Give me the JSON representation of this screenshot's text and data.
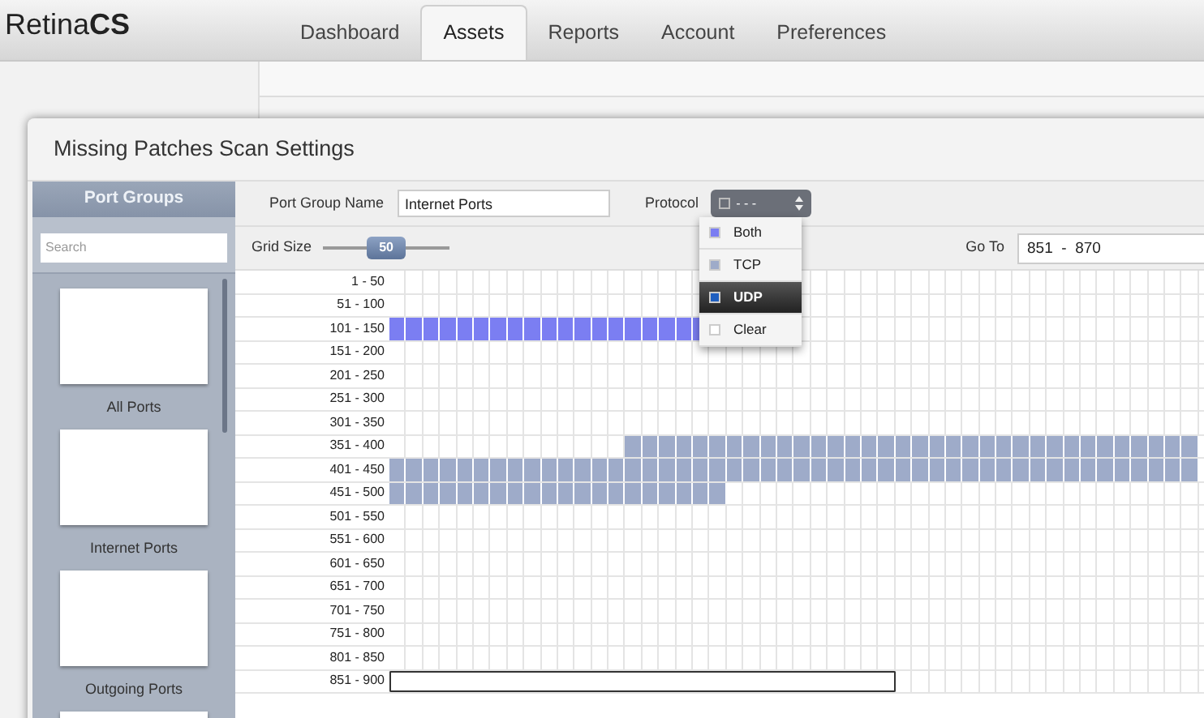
{
  "logo": "Retina**CS**",
  "tabs": [
    {
      "label": "Dashboard",
      "selected": false
    },
    {
      "label": "Assets",
      "selected": true
    },
    {
      "label": "Reports",
      "selected": false
    },
    {
      "label": "Account",
      "selected": false
    },
    {
      "label": "Preferences",
      "selected": false
    }
  ],
  "dialog": {
    "title": "Missing Patches Scan Settings",
    "sidebar": {
      "title": "Port Groups",
      "search": {
        "placeholder": "Search"
      },
      "groups": [
        {
          "label": "All Ports"
        },
        {
          "label": "Internet Ports"
        },
        {
          "label": "Outgoing Ports"
        }
      ],
      "more_below": true
    },
    "port_group_name": {
      "label": "Port Group Name",
      "value": "Internet Ports"
    },
    "protocol": {
      "label": "Protocol",
      "value": "- - -",
      "expanded": true,
      "options": [
        {
          "label": "Both",
          "color": "#7b7ef2",
          "selected": false
        },
        {
          "label": "TCP",
          "color": "#9eabc9",
          "selected": false
        },
        {
          "label": "UDP",
          "color": "#1f5fc0",
          "selected": true
        },
        {
          "label": "Clear",
          "color": "#ffffff",
          "selected": false
        }
      ]
    },
    "grid_size": {
      "label": "Grid Size",
      "value": "50",
      "level": 0.5
    },
    "go_to": {
      "label": "Go To",
      "value": "851  -  870"
    },
    "grid": {
      "rows": [
        {
          "label": "1 - 50"
        },
        {
          "label": "51 - 100"
        },
        {
          "label": "101 - 150",
          "cells": [
            {
              "kind": "both"
            },
            {
              "kind": "both"
            },
            {
              "kind": "both"
            },
            {
              "kind": "both"
            },
            {
              "kind": "both"
            },
            {
              "kind": "both"
            },
            {
              "kind": "both"
            },
            {
              "kind": "both"
            },
            {
              "kind": "both"
            },
            {
              "kind": "both"
            },
            {
              "kind": "both"
            },
            {
              "kind": "both"
            },
            {
              "kind": "both"
            },
            {
              "kind": "both"
            },
            {
              "kind": "both"
            },
            {
              "kind": "both"
            },
            {
              "kind": "both"
            },
            {
              "kind": "both"
            },
            {
              "kind": "both"
            }
          ]
        },
        {
          "label": "151 - 200"
        },
        {
          "label": "201 - 250"
        },
        {
          "label": "251 - 300"
        },
        {
          "label": "301 - 350"
        },
        {
          "label": "351 - 400",
          "cells": [
            {
              "kind": "empty"
            },
            {
              "kind": "empty"
            },
            {
              "kind": "empty"
            },
            {
              "kind": "empty"
            },
            {
              "kind": "empty"
            },
            {
              "kind": "empty"
            },
            {
              "kind": "empty"
            },
            {
              "kind": "empty"
            },
            {
              "kind": "empty"
            },
            {
              "kind": "empty"
            },
            {
              "kind": "empty"
            },
            {
              "kind": "empty"
            },
            {
              "kind": "empty"
            },
            {
              "kind": "empty"
            },
            {
              "kind": "tcp"
            },
            {
              "kind": "tcp"
            },
            {
              "kind": "tcp"
            },
            {
              "kind": "tcp"
            },
            {
              "kind": "tcp"
            },
            {
              "kind": "tcp"
            },
            {
              "kind": "tcp"
            },
            {
              "kind": "tcp"
            },
            {
              "kind": "tcp"
            },
            {
              "kind": "tcp"
            },
            {
              "kind": "tcp"
            },
            {
              "kind": "tcp"
            },
            {
              "kind": "tcp"
            },
            {
              "kind": "tcp"
            },
            {
              "kind": "tcp"
            },
            {
              "kind": "tcp"
            },
            {
              "kind": "tcp"
            },
            {
              "kind": "tcp"
            },
            {
              "kind": "tcp"
            },
            {
              "kind": "tcp"
            },
            {
              "kind": "tcp"
            },
            {
              "kind": "tcp"
            },
            {
              "kind": "tcp"
            },
            {
              "kind": "tcp"
            },
            {
              "kind": "tcp"
            },
            {
              "kind": "tcp"
            },
            {
              "kind": "tcp"
            },
            {
              "kind": "tcp"
            },
            {
              "kind": "tcp"
            },
            {
              "kind": "tcp"
            },
            {
              "kind": "tcp"
            },
            {
              "kind": "tcp"
            },
            {
              "kind": "tcp"
            },
            {
              "kind": "tcp"
            }
          ]
        },
        {
          "label": "401 - 450",
          "cells": [
            {
              "kind": "tcp"
            },
            {
              "kind": "tcp"
            },
            {
              "kind": "tcp"
            },
            {
              "kind": "tcp"
            },
            {
              "kind": "tcp"
            },
            {
              "kind": "tcp"
            },
            {
              "kind": "tcp"
            },
            {
              "kind": "tcp"
            },
            {
              "kind": "tcp"
            },
            {
              "kind": "tcp"
            },
            {
              "kind": "tcp"
            },
            {
              "kind": "tcp"
            },
            {
              "kind": "tcp"
            },
            {
              "kind": "tcp"
            },
            {
              "kind": "tcp"
            },
            {
              "kind": "tcp"
            },
            {
              "kind": "tcp"
            },
            {
              "kind": "tcp"
            },
            {
              "kind": "tcp"
            },
            {
              "kind": "tcp"
            },
            {
              "kind": "tcp"
            },
            {
              "kind": "tcp"
            },
            {
              "kind": "tcp"
            },
            {
              "kind": "tcp"
            },
            {
              "kind": "tcp"
            },
            {
              "kind": "tcp"
            },
            {
              "kind": "tcp"
            },
            {
              "kind": "tcp"
            },
            {
              "kind": "tcp"
            },
            {
              "kind": "tcp"
            },
            {
              "kind": "tcp"
            },
            {
              "kind": "tcp"
            },
            {
              "kind": "tcp"
            },
            {
              "kind": "tcp"
            },
            {
              "kind": "tcp"
            },
            {
              "kind": "tcp"
            },
            {
              "kind": "tcp"
            },
            {
              "kind": "tcp"
            },
            {
              "kind": "tcp"
            },
            {
              "kind": "tcp"
            },
            {
              "kind": "tcp"
            },
            {
              "kind": "tcp"
            },
            {
              "kind": "tcp"
            },
            {
              "kind": "tcp"
            },
            {
              "kind": "tcp"
            },
            {
              "kind": "tcp"
            },
            {
              "kind": "tcp"
            },
            {
              "kind": "tcp"
            }
          ]
        },
        {
          "label": "451 - 500",
          "cells": [
            {
              "kind": "tcp"
            },
            {
              "kind": "tcp"
            },
            {
              "kind": "tcp"
            },
            {
              "kind": "tcp"
            },
            {
              "kind": "tcp"
            },
            {
              "kind": "tcp"
            },
            {
              "kind": "tcp"
            },
            {
              "kind": "tcp"
            },
            {
              "kind": "tcp"
            },
            {
              "kind": "tcp"
            },
            {
              "kind": "tcp"
            },
            {
              "kind": "tcp"
            },
            {
              "kind": "tcp"
            },
            {
              "kind": "tcp"
            },
            {
              "kind": "tcp"
            },
            {
              "kind": "tcp"
            },
            {
              "kind": "tcp"
            },
            {
              "kind": "tcp"
            },
            {
              "kind": "tcp"
            },
            {
              "kind": "tcp"
            }
          ]
        },
        {
          "label": "501 - 550"
        },
        {
          "label": "551 - 600"
        },
        {
          "label": "601 - 650"
        },
        {
          "label": "651 - 700"
        },
        {
          "label": "701 - 750"
        },
        {
          "label": "751 - 800"
        },
        {
          "label": "801 - 850"
        },
        {
          "label": "851 - 900",
          "cells": [
            {
              "kind": "selected"
            },
            {
              "kind": "selected"
            },
            {
              "kind": "selected"
            },
            {
              "kind": "selected"
            },
            {
              "kind": "selected"
            },
            {
              "kind": "selected"
            },
            {
              "kind": "selected"
            },
            {
              "kind": "selected"
            },
            {
              "kind": "selected"
            },
            {
              "kind": "selected"
            },
            {
              "kind": "selected"
            },
            {
              "kind": "selected"
            },
            {
              "kind": "selected"
            },
            {
              "kind": "selected"
            },
            {
              "kind": "selected"
            },
            {
              "kind": "selected"
            },
            {
              "kind": "selected"
            },
            {
              "kind": "selected"
            },
            {
              "kind": "selected"
            },
            {
              "kind": "selected"
            },
            {
              "kind": "selected"
            },
            {
              "kind": "selected"
            },
            {
              "kind": "selected"
            },
            {
              "kind": "selected"
            },
            {
              "kind": "selected"
            },
            {
              "kind": "selected"
            },
            {
              "kind": "selected"
            },
            {
              "kind": "selected"
            },
            {
              "kind": "selected"
            },
            {
              "kind": "selected"
            }
          ]
        }
      ]
    }
  }
}
